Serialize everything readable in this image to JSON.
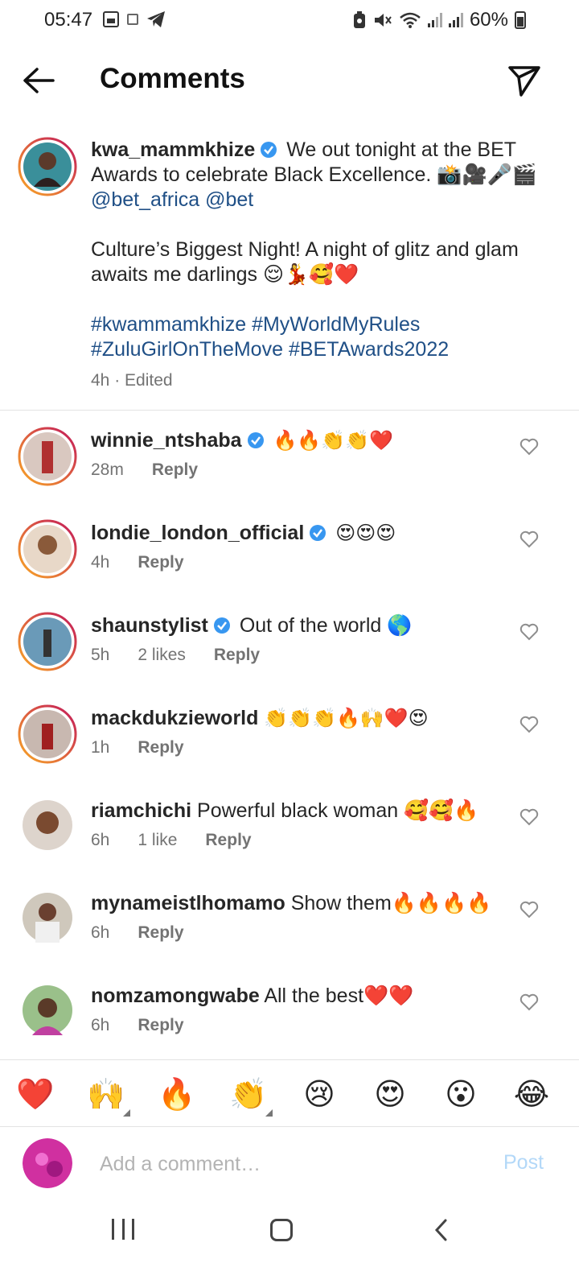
{
  "status_bar": {
    "time": "05:47",
    "battery": "60%",
    "icons": [
      "gallery-icon",
      "app-icon",
      "telegram-icon",
      "battery-saver-icon",
      "mute-icon",
      "wifi-icon",
      "signal-icon",
      "signal-icon",
      "battery-icon"
    ]
  },
  "header": {
    "title": "Comments",
    "back_icon": "arrow-left-icon",
    "share_icon": "paper-plane-icon"
  },
  "caption": {
    "username": "kwa_mammkhize",
    "text_1": "We out tonight at the BET Awards to celebrate Black Excellence. 📸🎥🎤🎬",
    "mention_1": "@bet_africa",
    "mention_2": "@bet",
    "text_2": "Culture’s Biggest Night! A night of glitz and glam awaits me darlings 😌💃🥰❤️",
    "hashtag_1": "#kwammamkhize",
    "hashtag_2": "#MyWorldMyRules",
    "hashtag_3": "#ZuluGirlOnTheMove",
    "hashtag_4": "#BETAwards2022",
    "meta": "4h · Edited"
  },
  "comments": [
    {
      "username": "winnie_ntshaba",
      "verified": true,
      "text": "🔥🔥👏👏❤️",
      "time": "28m",
      "likes": "",
      "reply": "Reply"
    },
    {
      "username": "londie_london_official",
      "verified": true,
      "text": "😍😍😍",
      "time": "4h",
      "likes": "",
      "reply": "Reply"
    },
    {
      "username": "shaunstylist",
      "verified": true,
      "text": "Out of the world 🌎",
      "time": "5h",
      "likes": "2 likes",
      "reply": "Reply"
    },
    {
      "username": "mackdukzieworld",
      "verified": false,
      "text": "👏👏👏🔥🙌❤️😍",
      "time": "1h",
      "likes": "",
      "reply": "Reply"
    },
    {
      "username": "riamchichi",
      "verified": false,
      "text": "Powerful black woman 🥰🥰🔥",
      "time": "6h",
      "likes": "1 like",
      "reply": "Reply"
    },
    {
      "username": "mynameistlhomamo",
      "verified": false,
      "text": "Show them🔥🔥🔥🔥",
      "time": "6h",
      "likes": "",
      "reply": "Reply"
    },
    {
      "username": "nomzamongwabe",
      "verified": false,
      "text": "All the best❤️❤️",
      "time": "6h",
      "likes": "",
      "reply": "Reply"
    }
  ],
  "emoji_bar": [
    "❤️",
    "🙌",
    "🔥",
    "👏",
    "😢",
    "😍",
    "😮",
    "😂"
  ],
  "composer": {
    "placeholder": "Add a comment…",
    "post_label": "Post"
  },
  "colors": {
    "link": "#1f4f86",
    "verified": "#3897f0",
    "muted": "#737373",
    "post_disabled": "#b3d8f8",
    "ring_start": "#f9a825",
    "ring_end": "#c2185b"
  }
}
